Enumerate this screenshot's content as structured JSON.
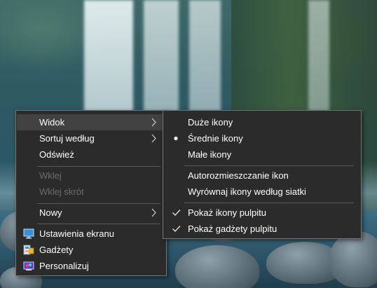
{
  "main_menu": {
    "items": [
      {
        "label": "Widok"
      },
      {
        "label": "Sortuj według"
      },
      {
        "label": "Odśwież"
      },
      {
        "label": "Wklej"
      },
      {
        "label": "Wklej skrót"
      },
      {
        "label": "Nowy"
      },
      {
        "label": "Ustawienia ekranu",
        "icon": "display-settings-icon"
      },
      {
        "label": "Gadżety",
        "icon": "gadgets-icon"
      },
      {
        "label": "Personalizuj",
        "icon": "personalize-icon"
      }
    ]
  },
  "view_submenu": {
    "items": [
      {
        "label": "Duże ikony"
      },
      {
        "label": "Średnie ikony",
        "selected": true
      },
      {
        "label": "Małe ikony"
      },
      {
        "label": "Autorozmieszczanie ikon"
      },
      {
        "label": "Wyrównaj ikony według siatki"
      },
      {
        "label": "Pokaż ikony pulpitu",
        "checked": true
      },
      {
        "label": "Pokaż gadżety pulpitu",
        "checked": true
      }
    ]
  },
  "colors": {
    "menu_background": "#2b2b2b",
    "menu_border": "#767676",
    "hover_background": "#414141",
    "text": "#ffffff",
    "disabled_text": "#6d6d6d"
  }
}
